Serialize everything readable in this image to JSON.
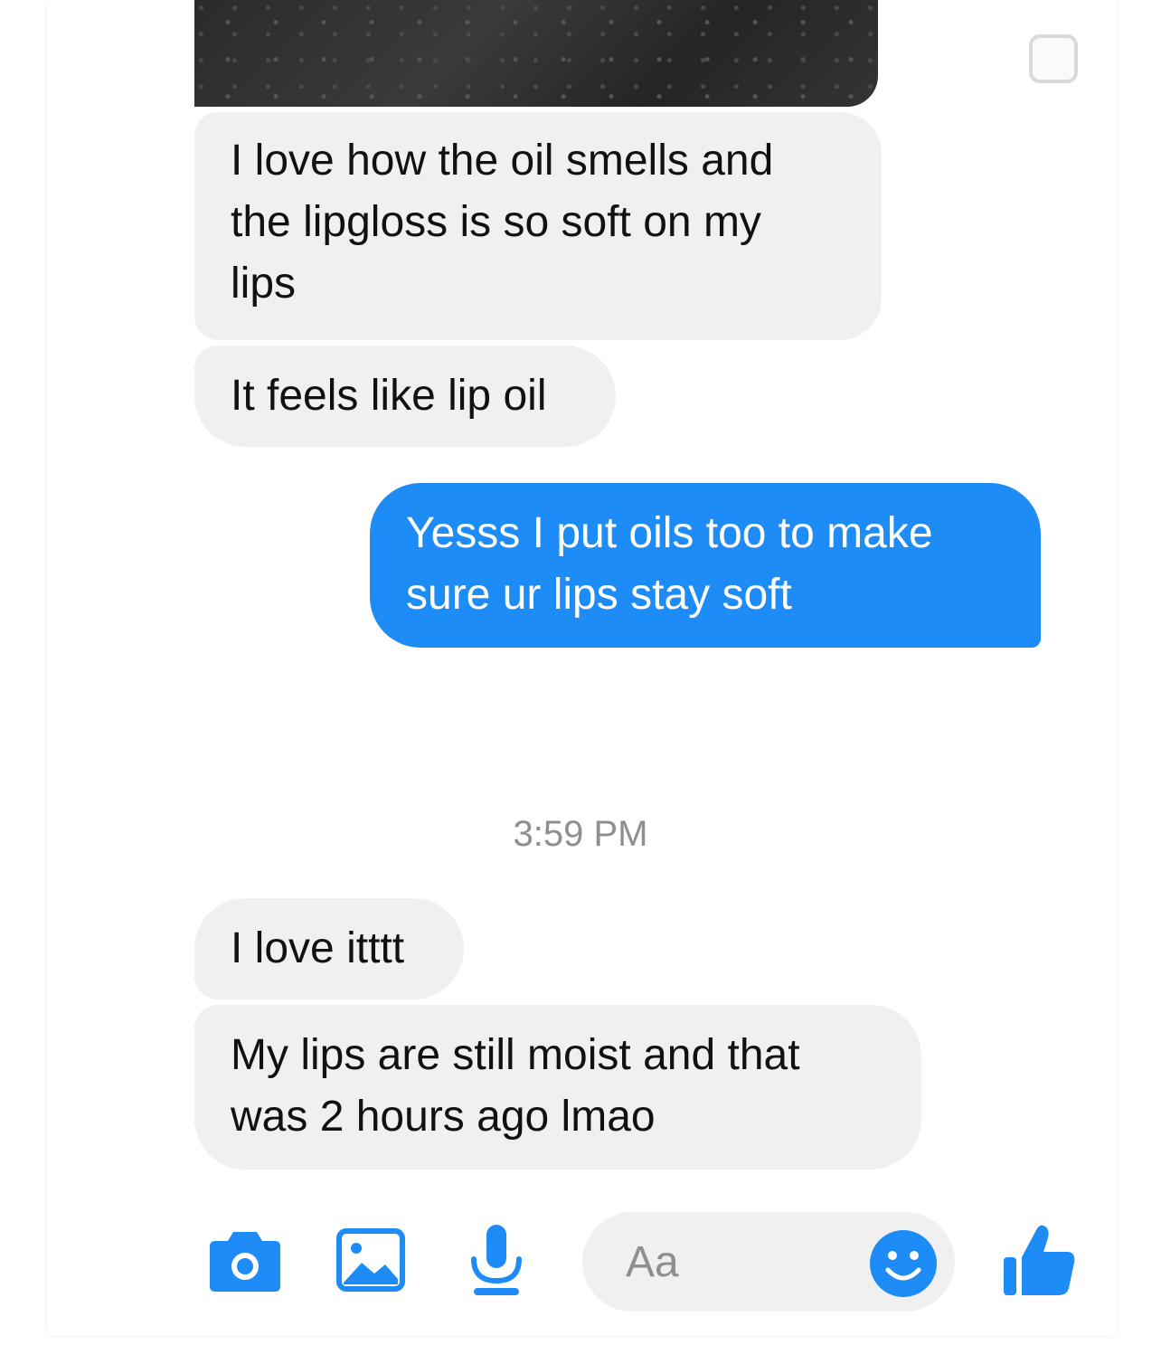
{
  "conversation": {
    "messages": [
      {
        "from": "them",
        "text": "I love how the oil smells and\nthe lipgloss is so soft on my\nlips"
      },
      {
        "from": "them",
        "text": "It feels like lip oil"
      },
      {
        "from": "me",
        "text": "Yesss I put oils too to make\nsure ur lips stay soft"
      },
      {
        "from": "them",
        "text": "I love itttt"
      },
      {
        "from": "them",
        "text": "My lips are still moist and that\nwas 2 hours ago lmao"
      }
    ],
    "timestamp": "3:59 PM"
  },
  "composer": {
    "placeholder": "Aa",
    "icons": [
      "camera-icon",
      "image-icon",
      "microphone-icon",
      "emoji-icon",
      "thumbs-up-icon"
    ]
  },
  "colors": {
    "accent": "#1e8cf7",
    "incoming_bubble": "#f0f0f0",
    "outgoing_bubble": "#1e8cf7",
    "timestamp_text": "#8e8e93"
  }
}
